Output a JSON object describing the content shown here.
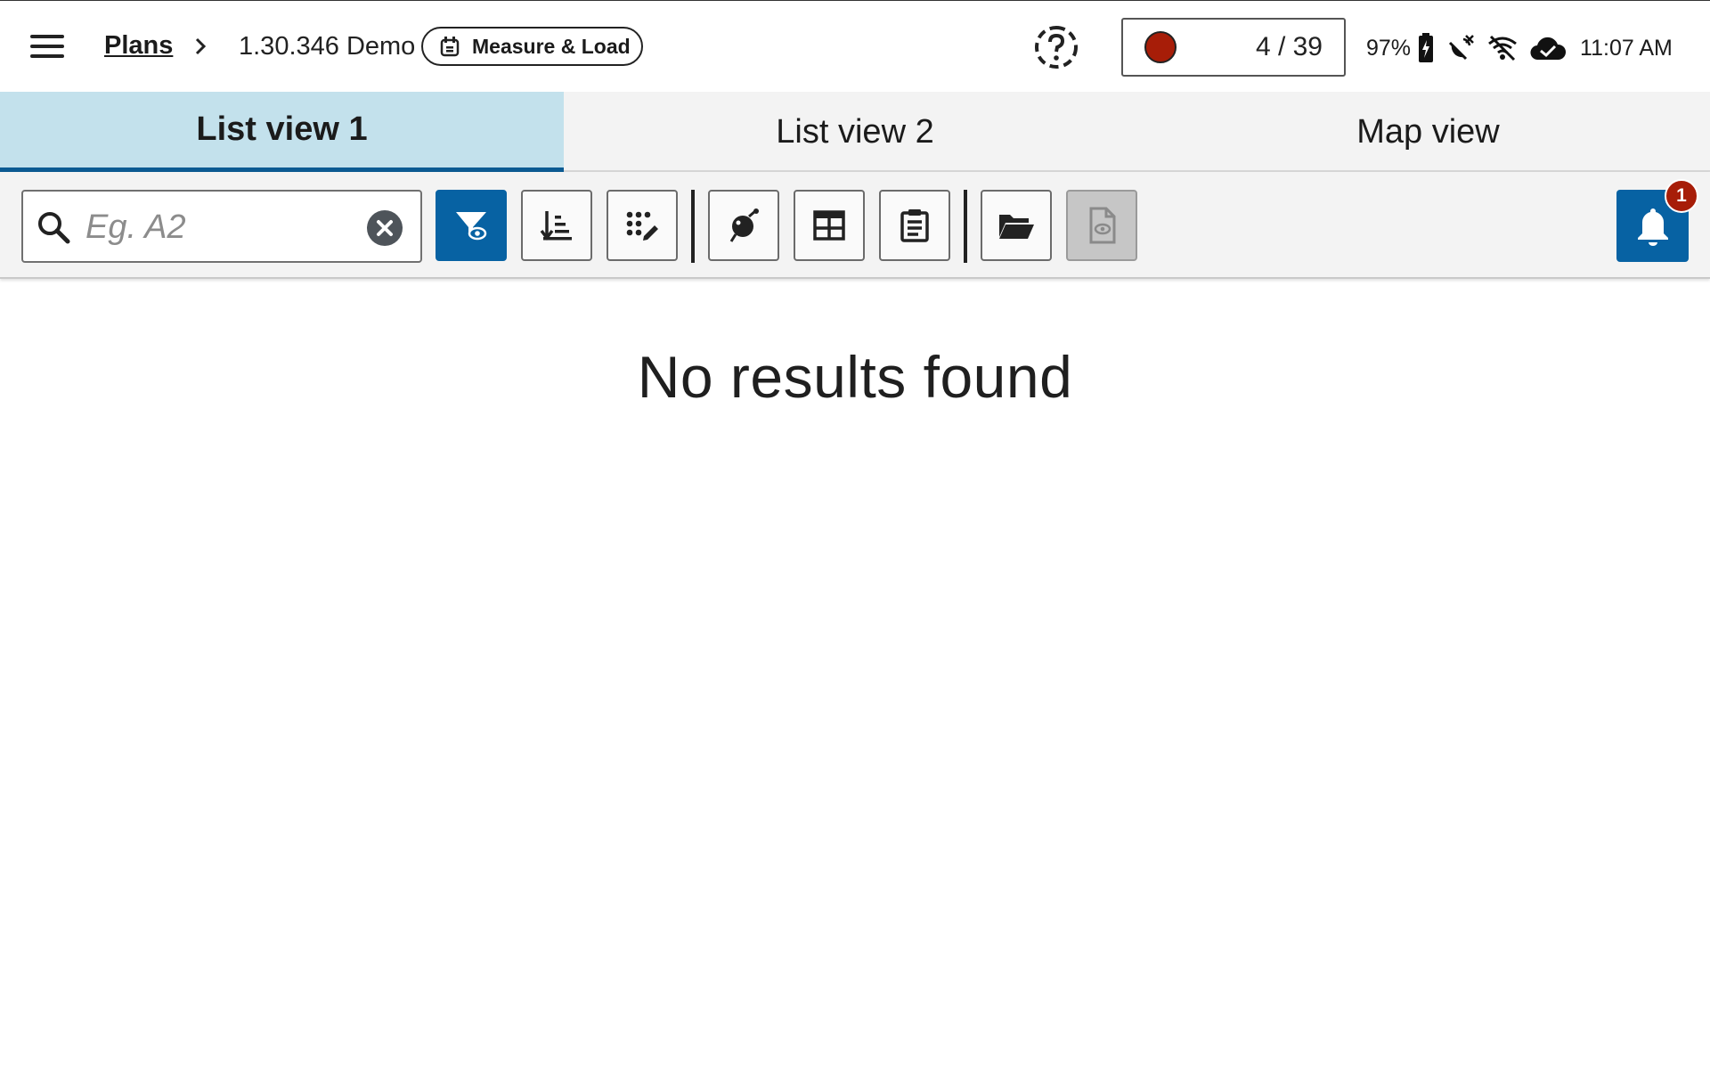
{
  "header": {
    "menu_icon": "hamburger-menu-icon",
    "breadcrumb_link": "Plans",
    "breadcrumb_separator_icon": "chevron-right-icon",
    "plan_name": "1.30.346 Demo",
    "mode_chip": {
      "icon": "measure-load-icon",
      "label": "Measure & Load"
    },
    "help_icon": "help-question-icon",
    "recorder": {
      "status_color": "#a71d08",
      "count": "4 / 39"
    },
    "status": {
      "battery_percent": "97%",
      "battery_icon": "battery-charging-icon",
      "gps_icon": "satellite-off-icon",
      "wifi_icon": "wifi-off-icon",
      "cloud_icon": "cloud-done-icon",
      "time": "11:07 AM"
    }
  },
  "tabs": [
    {
      "label": "List view 1",
      "active": true
    },
    {
      "label": "List view 2",
      "active": false
    },
    {
      "label": "Map view",
      "active": false
    }
  ],
  "toolbar": {
    "search": {
      "placeholder": "Eg. A2",
      "value": ""
    },
    "buttons": [
      {
        "name": "filter-view-icon",
        "active": true
      },
      {
        "name": "sort-icon"
      },
      {
        "name": "grid-edit-icon"
      },
      {
        "name": "tag-icon"
      },
      {
        "name": "table-icon"
      },
      {
        "name": "clipboard-icon"
      },
      {
        "name": "folder-open-icon"
      },
      {
        "name": "document-preview-icon",
        "disabled": true
      }
    ],
    "notifications": {
      "icon": "bell-icon",
      "count": "1"
    }
  },
  "colors": {
    "accent": "#0762a3",
    "active_tab": "#c3e1ec",
    "alert": "#a71d08"
  },
  "content": {
    "empty_message": "No results found"
  }
}
